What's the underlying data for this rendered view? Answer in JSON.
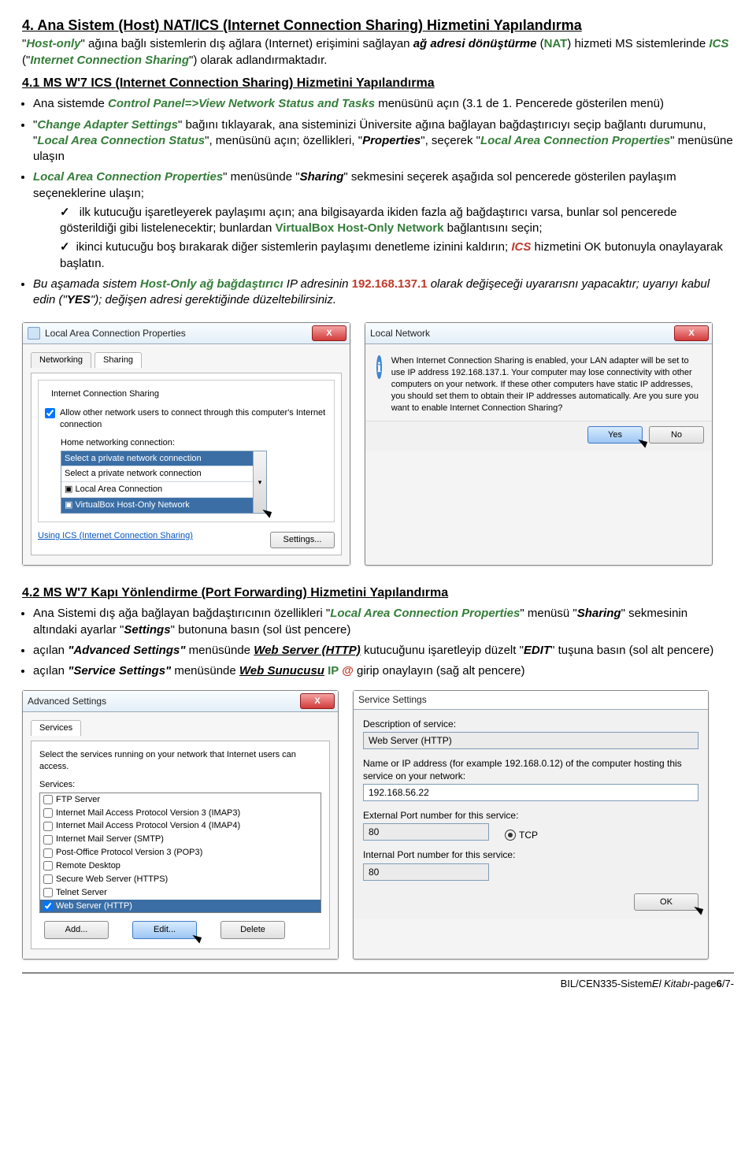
{
  "headings": {
    "h4": "4. Ana Sistem (Host) NAT/ICS (Internet Connection Sharing) Hizmetini Yapılandırma",
    "h41": "4.1 MS W'7 ICS (Internet Connection Sharing) Hizmetini Yapılandırma",
    "h42": "4.2 MS W'7 Kapı Yönlendirme (Port Forwarding) Hizmetini Yapılandırma"
  },
  "intro": {
    "p1_a": "\"",
    "p1_host": "Host-only",
    "p1_b": "\" ağına bağlı sistemlerin dış ağlara (Internet) erişimini sağlayan ",
    "p1_c": "ağ adresi dönüştürme",
    "p1_d": " (",
    "p1_nat": "NAT",
    "p1_e": ") hizmeti MS sistemlerinde ",
    "p1_ics": "ICS",
    "p1_f": " (\"",
    "p1_icsfull": "Internet Connection Sharing",
    "p1_g": "\") olarak adlandırmaktadır."
  },
  "s41_b1_a": "Ana sistemde ",
  "s41_b1_b": "Control Panel=>View Network Status and Tasks",
  "s41_b1_c": " menüsünü açın (3.1 de 1. Pencerede gösterilen menü)",
  "s41_b2_a": "\"",
  "s41_b2_cas": "Change Adapter Settings",
  "s41_b2_b": "\" bağını tıklayarak, ana sisteminizi Üniversite ağına bağlayan bağdaştırıcıyı seçip bağlantı durumunu, \"",
  "s41_b2_lacs": "Local Area Connection Status",
  "s41_b2_c": "\", menüsünü açın; özellikleri, \"",
  "s41_b2_prop": "Properties",
  "s41_b2_d": "\", seçerek \"",
  "s41_b2_lacp": "Local Area Connection Properties",
  "s41_b2_e": "\" menüsüne ulaşın",
  "s41_b3_a": "Local Area Connection Properties",
  "s41_b3_b": "\" menüsünde \"",
  "s41_b3_share": "Sharing",
  "s41_b3_c": "\" sekmesini seçerek aşağıda sol pencerede gösterilen paylaşım seçeneklerine ulaşın;",
  "s41_t1_a": " ilk kutucuğu işaretleyerek paylaşımı açın; ana bilgisayarda ikiden fazla ağ bağdaştırıcı varsa, bunlar sol pencerede gösterildiği gibi listelenecektir; bunlardan ",
  "s41_t1_b": "VirtualBox Host-Only Network",
  "s41_t1_c": " bağlantısını seçin;",
  "s41_t2_a": "ikinci kutucuğu boş bırakarak diğer sistemlerin paylaşımı denetleme izinini kaldırın; ",
  "s41_t2_ics": "ICS",
  "s41_t2_b": " hizmetini OK butonuyla onaylayarak başlatın.",
  "s41_b4_a": "Bu aşamada sistem ",
  "s41_b4_ho": "Host-Only ağ bağdaştırıcı",
  "s41_b4_b": " IP adresinin ",
  "s41_b4_ip": "192.168.137.1",
  "s41_b4_c": " olarak değişeceği uyararısnı yapacaktır; uyarıyı kabul edin (\"",
  "s41_b4_yes": "YES",
  "s41_b4_d": "\"); değişen adresi gerektiğinde düzeltebilirsiniz.",
  "img1": {
    "title": "Local Area Connection Properties",
    "tabs": {
      "net": "Networking",
      "share": "Sharing"
    },
    "group": "Internet Connection Sharing",
    "chk1": "Allow other network users to connect through this computer's Internet connection",
    "homelabel": "Home networking connection:",
    "dd_sel": "Select a private network connection",
    "dd_o1": "Select a private network connection",
    "dd_o2": "Local Area Connection",
    "dd_o3": "VirtualBox Host-Only Network",
    "link": "Using ICS (Internet Connection Sharing)",
    "settings": "Settings..."
  },
  "img2": {
    "title": "Local Network",
    "msg": "When Internet Connection Sharing is enabled, your LAN adapter will be set to use IP address 192.168.137.1. Your computer may lose connectivity with other computers on your network. If these other computers have static IP addresses, you should set them to obtain their IP addresses automatically. Are you sure you want to enable Internet Connection Sharing?",
    "yes": "Yes",
    "no": "No"
  },
  "s42_b1_a": "Ana Sistemi dış ağa bağlayan bağdaştırıcının özellikleri \"",
  "s42_b1_lacp": "Local Area Connection Properties",
  "s42_b1_b": "\" menüsü \"",
  "s42_b1_share": "Sharing",
  "s42_b1_c": "\" sekmesinin altındaki ayarlar \"",
  "s42_b1_set": "Settings",
  "s42_b1_d": "\" butonuna basın (sol üst pencere)",
  "s42_b2_a": "açılan ",
  "s42_b2_as": "\"Advanced Settings\"",
  "s42_b2_b": " menüsünde ",
  "s42_b2_ws": "Web Server (HTTP)",
  "s42_b2_c": " kutucuğunu işaretleyip düzelt \"",
  "s42_b2_edit": "EDIT",
  "s42_b2_d": "\"  tuşuna basın (sol alt pencere)",
  "s42_b3_a": "açılan ",
  "s42_b3_ss": "\"Service Settings\"",
  "s42_b3_b": " menüsünde ",
  "s42_b3_ws": "Web Sunucusu",
  "s42_b3_ip": " IP",
  "s42_b3_at": " @",
  "s42_b3_c": " girip onaylayın (sağ alt pencere)",
  "adv": {
    "title": "Advanced Settings",
    "tab": "Services",
    "desc": "Select the services running on your network that Internet users can access.",
    "label": "Services:",
    "items": [
      {
        "c": false,
        "t": "FTP Server"
      },
      {
        "c": false,
        "t": "Internet Mail Access Protocol Version 3 (IMAP3)"
      },
      {
        "c": false,
        "t": "Internet Mail Access Protocol Version 4 (IMAP4)"
      },
      {
        "c": false,
        "t": "Internet Mail Server (SMTP)"
      },
      {
        "c": false,
        "t": "Post-Office Protocol Version 3 (POP3)"
      },
      {
        "c": false,
        "t": "Remote Desktop"
      },
      {
        "c": false,
        "t": "Secure Web Server (HTTPS)"
      },
      {
        "c": false,
        "t": "Telnet Server"
      },
      {
        "c": true,
        "t": "Web Server (HTTP)"
      }
    ],
    "add": "Add...",
    "edit": "Edit...",
    "del": "Delete"
  },
  "ss": {
    "title": "Service Settings",
    "l1": "Description of service:",
    "v1": "Web Server (HTTP)",
    "l2": "Name or IP address (for example 192.168.0.12) of the computer hosting this service on your network:",
    "v2": "192.168.56.22",
    "l3": "External Port number for this service:",
    "v3": "80",
    "tcp": "TCP",
    "l4": "Internal Port number for this service:",
    "v4": "80",
    "ok": "OK"
  },
  "footer": {
    "a": "BIL/CEN335-Sistem ",
    "b": "El Kitabı",
    "c": "   -page ",
    "pg": "6",
    "d": "/7-"
  }
}
